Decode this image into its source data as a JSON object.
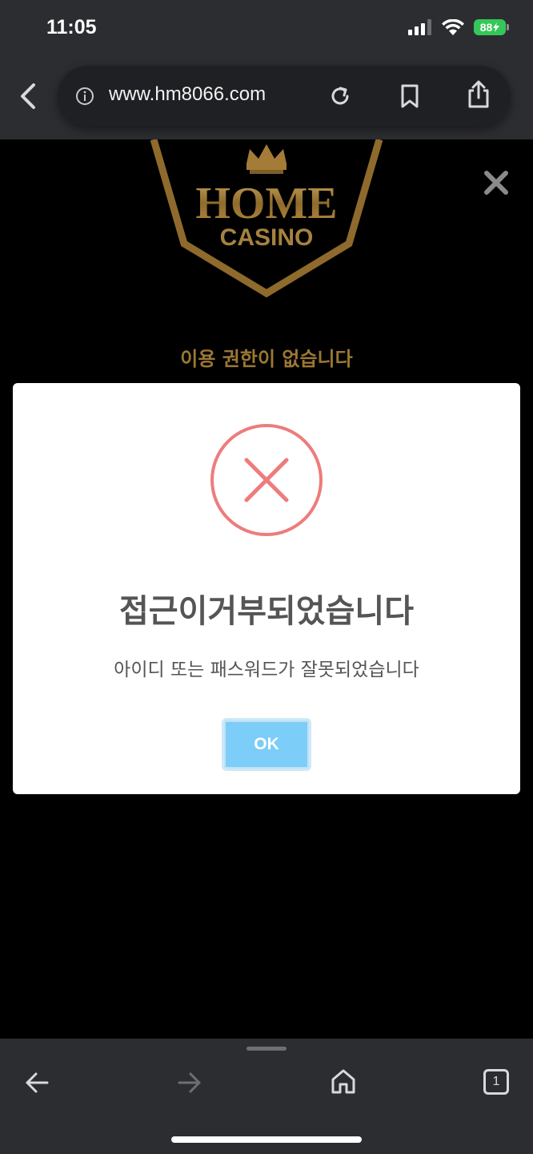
{
  "status_bar": {
    "time": "11:05",
    "battery": "88",
    "icons": [
      "cellular-signal-icon",
      "wifi-icon",
      "battery-charging-icon"
    ]
  },
  "browser": {
    "url": "www.hm8066.com",
    "tab_count": "1",
    "icons": [
      "back-chevron-icon",
      "info-icon",
      "reload-icon",
      "bookmark-icon",
      "share-icon",
      "arrow-left-icon",
      "arrow-right-icon",
      "home-icon",
      "tabs-icon"
    ]
  },
  "page": {
    "logo_text_top": "HOME",
    "logo_text_bottom": "CASINO",
    "notice": "이용 권한이 없습니다",
    "colors": {
      "gold": "#9c7734",
      "background": "#000000"
    }
  },
  "modal": {
    "title": "접근이거부되었습니다",
    "message": "아이디 또는 패스워드가 잘못되었습니다",
    "ok_label": "OK",
    "colors": {
      "error_red": "#ee7c7c",
      "ok_blue": "#7ccdf7"
    }
  }
}
